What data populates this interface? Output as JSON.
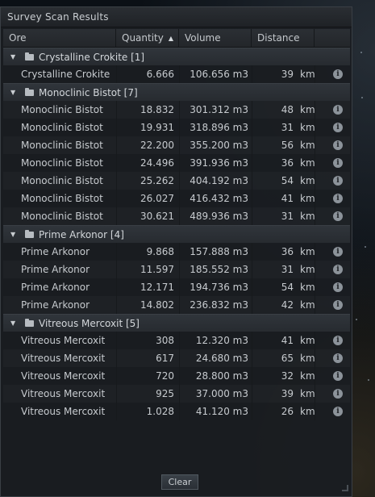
{
  "window": {
    "title": "Survey Scan Results"
  },
  "columns": {
    "ore": "Ore",
    "quantity": "Quantity",
    "volume": "Volume",
    "distance": "Distance"
  },
  "groups": [
    {
      "name": "Crystalline Crokite [1]",
      "rows": [
        {
          "ore": "Crystalline Crokite",
          "qty": "6.666",
          "vol": "106.656 m3",
          "dist": "39",
          "unit": "km"
        }
      ]
    },
    {
      "name": "Monoclinic Bistot [7]",
      "rows": [
        {
          "ore": "Monoclinic Bistot",
          "qty": "18.832",
          "vol": "301.312 m3",
          "dist": "48",
          "unit": "km"
        },
        {
          "ore": "Monoclinic Bistot",
          "qty": "19.931",
          "vol": "318.896 m3",
          "dist": "31",
          "unit": "km"
        },
        {
          "ore": "Monoclinic Bistot",
          "qty": "22.200",
          "vol": "355.200 m3",
          "dist": "56",
          "unit": "km"
        },
        {
          "ore": "Monoclinic Bistot",
          "qty": "24.496",
          "vol": "391.936 m3",
          "dist": "36",
          "unit": "km"
        },
        {
          "ore": "Monoclinic Bistot",
          "qty": "25.262",
          "vol": "404.192 m3",
          "dist": "54",
          "unit": "km"
        },
        {
          "ore": "Monoclinic Bistot",
          "qty": "26.027",
          "vol": "416.432 m3",
          "dist": "41",
          "unit": "km"
        },
        {
          "ore": "Monoclinic Bistot",
          "qty": "30.621",
          "vol": "489.936 m3",
          "dist": "31",
          "unit": "km"
        }
      ]
    },
    {
      "name": "Prime Arkonor [4]",
      "rows": [
        {
          "ore": "Prime Arkonor",
          "qty": "9.868",
          "vol": "157.888 m3",
          "dist": "36",
          "unit": "km"
        },
        {
          "ore": "Prime Arkonor",
          "qty": "11.597",
          "vol": "185.552 m3",
          "dist": "31",
          "unit": "km"
        },
        {
          "ore": "Prime Arkonor",
          "qty": "12.171",
          "vol": "194.736 m3",
          "dist": "54",
          "unit": "km"
        },
        {
          "ore": "Prime Arkonor",
          "qty": "14.802",
          "vol": "236.832 m3",
          "dist": "42",
          "unit": "km"
        }
      ]
    },
    {
      "name": "Vitreous Mercoxit [5]",
      "rows": [
        {
          "ore": "Vitreous Mercoxit",
          "qty": "308",
          "vol": "12.320 m3",
          "dist": "41",
          "unit": "km"
        },
        {
          "ore": "Vitreous Mercoxit",
          "qty": "617",
          "vol": "24.680 m3",
          "dist": "65",
          "unit": "km"
        },
        {
          "ore": "Vitreous Mercoxit",
          "qty": "720",
          "vol": "28.800 m3",
          "dist": "32",
          "unit": "km"
        },
        {
          "ore": "Vitreous Mercoxit",
          "qty": "925",
          "vol": "37.000 m3",
          "dist": "39",
          "unit": "km"
        },
        {
          "ore": "Vitreous Mercoxit",
          "qty": "1.028",
          "vol": "41.120 m3",
          "dist": "26",
          "unit": "km"
        }
      ]
    }
  ],
  "icons": {
    "info": "i",
    "sort": "▲",
    "expand": "▼"
  },
  "footer": {
    "clear_label": "Clear"
  }
}
